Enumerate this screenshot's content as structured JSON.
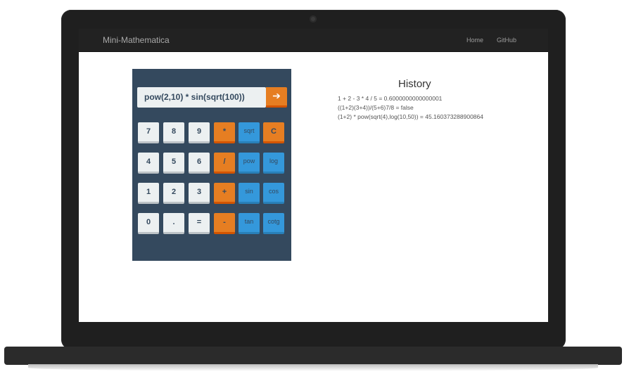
{
  "navbar": {
    "brand": "Mini-Mathematica",
    "links": [
      "Home",
      "GitHub"
    ]
  },
  "calculator": {
    "expression": "pow(2,10)  *  sin(sqrt(100))",
    "evaluate_icon": "arrow-right-icon",
    "evaluate_glyph": "➔",
    "rows": [
      [
        "7",
        "8",
        "9",
        "*",
        "sqrt",
        "C"
      ],
      [
        "4",
        "5",
        "6",
        "/",
        "pow",
        "log"
      ],
      [
        "1",
        "2",
        "3",
        "+",
        "sin",
        "cos"
      ],
      [
        "0",
        ".",
        "=",
        "-",
        "tan",
        "cotg"
      ]
    ]
  },
  "history": {
    "title": "History",
    "entries": [
      "1 + 2 - 3 * 4 / 5 = 0.6000000000000001",
      "((1+2)(3+4))/(5+6)7/8 = false",
      "(1+2) * pow(sqrt(4),log(10,50)) = 45.160373288900864"
    ]
  },
  "colors": {
    "navbar": "#222222",
    "calculator_panel": "#34495e",
    "digit_key": "#ecf0f1",
    "operator_key": "#e67e22",
    "function_key": "#3498db"
  }
}
